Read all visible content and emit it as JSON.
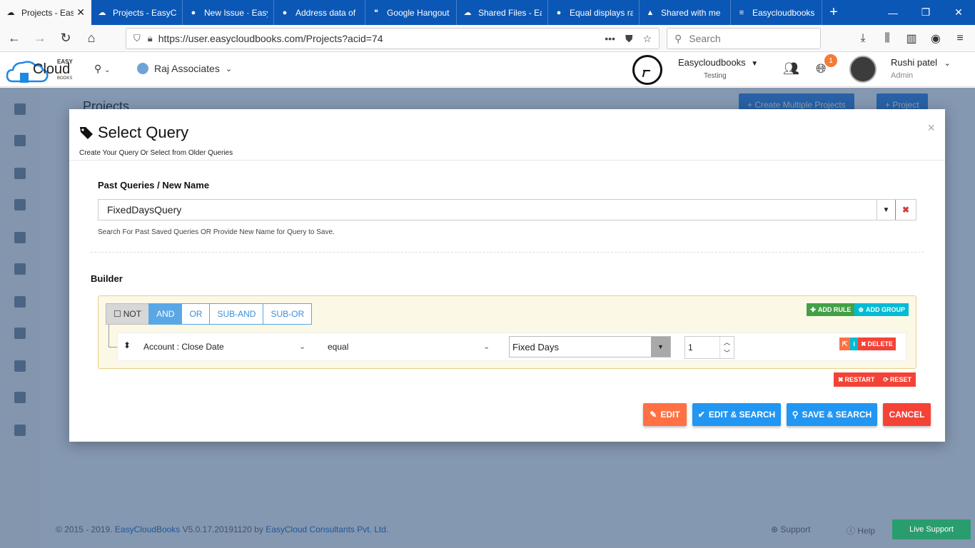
{
  "browser": {
    "tabs": [
      {
        "label": "Projects - Eas",
        "icon": "cloud-favicon-icon",
        "glyph": "☁",
        "active": true
      },
      {
        "label": "Projects - EasyCl",
        "icon": "cloud-favicon-icon",
        "glyph": "☁",
        "active": false
      },
      {
        "label": "New Issue · Easy",
        "icon": "github-icon",
        "glyph": "●",
        "active": false
      },
      {
        "label": "Address data of",
        "icon": "github-icon",
        "glyph": "●",
        "active": false
      },
      {
        "label": "Google Hangout",
        "icon": "hangouts-icon",
        "glyph": "❝",
        "active": false
      },
      {
        "label": "Shared Files - Ea",
        "icon": "cloud-favicon-icon",
        "glyph": "☁",
        "active": false
      },
      {
        "label": "Equal displays ra",
        "icon": "github-icon",
        "glyph": "●",
        "active": false
      },
      {
        "label": "Shared with me",
        "icon": "google-drive-icon",
        "glyph": "▲",
        "active": false
      },
      {
        "label": "Easycloudbooks",
        "icon": "docs-icon",
        "glyph": "≡",
        "active": false
      }
    ],
    "url": "https://user.easycloudbooks.com/Projects?acid=74",
    "search_placeholder": "Search"
  },
  "header": {
    "logo_top": "EASY",
    "logo_main": "Cloud",
    "logo_bottom": "BOOKS",
    "company": "Raj Associates",
    "org_name": "Easycloudbooks",
    "org_sub": "Testing",
    "notification_count": "1",
    "user_name": "Rushi patel",
    "user_role": "Admin"
  },
  "background": {
    "page_title": "Projects",
    "btn_multiple": "+ Create Multiple Projects",
    "btn_project": "+ Project",
    "footer_prefix": "© 2015 - 2019. ",
    "footer_brand": "EasyCloudBooks",
    "footer_version": " V5.0.17.20191120 by ",
    "footer_company": "EasyCloud Consultants Pvt. Ltd.",
    "support": "Support",
    "help": "Help",
    "live_support": "Live Support"
  },
  "modal": {
    "title": "Select Query",
    "subtitle": "Create Your Query Or Select from Older Queries",
    "past_label": "Past Queries / New Name",
    "query_value": "FixedDaysQuery",
    "help_text": "Search For Past Saved Queries OR Provide New Name for Query to Save.",
    "builder_label": "Builder",
    "conditions": {
      "not": "NOT",
      "and": "AND",
      "or": "OR",
      "sub_and": "SUB-AND",
      "sub_or": "SUB-OR"
    },
    "add_rule": "ADD RULE",
    "add_group": "ADD GROUP",
    "rule": {
      "field": "Account : Close Date",
      "operator": "equal",
      "value_type": "Fixed Days",
      "value": "1"
    },
    "delete": "DELETE",
    "restart": "RESTART",
    "reset": "RESET",
    "buttons": {
      "edit": "EDIT",
      "edit_search": "EDIT & SEARCH",
      "save_search": "SAVE & SEARCH",
      "cancel": "CANCEL"
    }
  },
  "colors": {
    "tabbar": "#0b57b5",
    "edit": "#ff7043",
    "primary": "#2196f3",
    "cancel": "#f44336",
    "add_rule": "#43a047",
    "add_group": "#00bcd4"
  }
}
